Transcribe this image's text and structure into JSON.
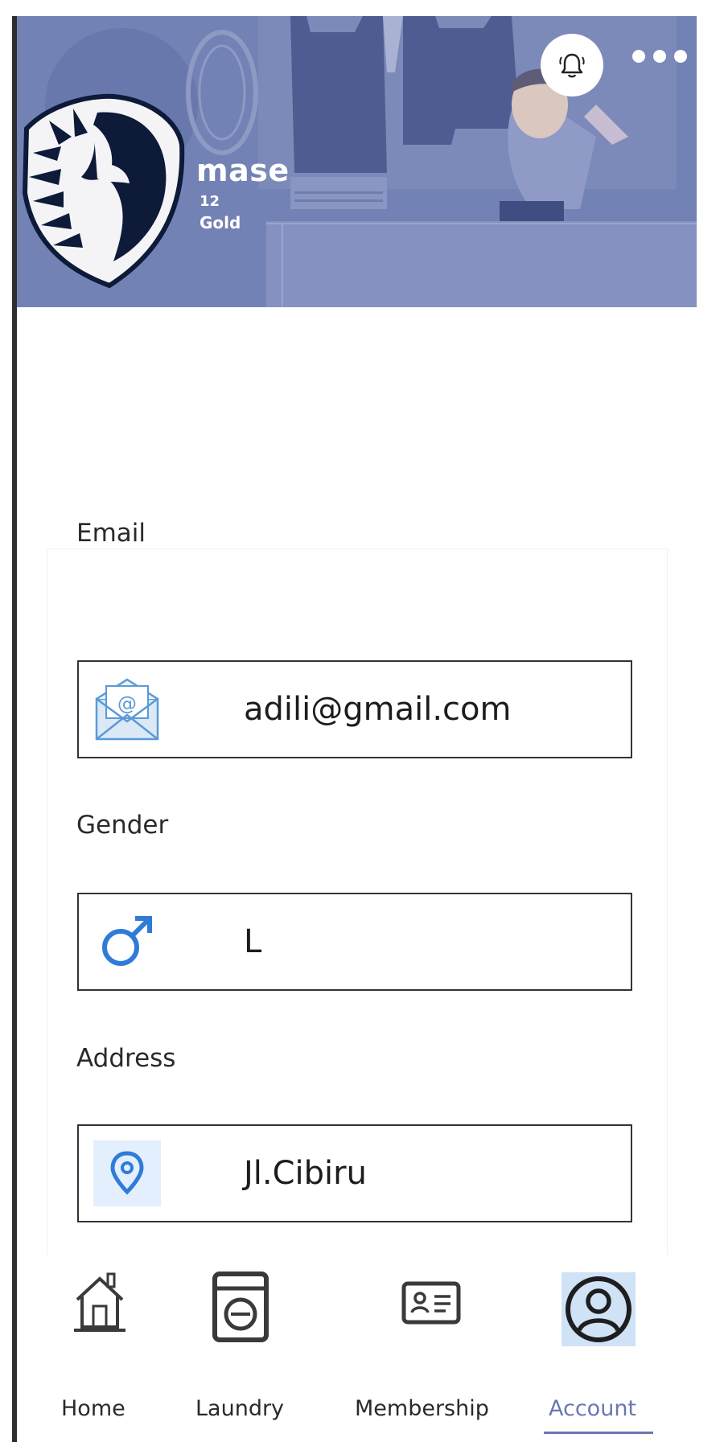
{
  "profile": {
    "name": "mase",
    "points": "12",
    "tier": "Gold"
  },
  "header": {
    "background_color": "#7382b5",
    "notification_icon": "bell-icon",
    "more_icon": "more-dots-icon",
    "avatar_icon": "horse-shield-logo"
  },
  "fields": {
    "email": {
      "label": "Email",
      "value": "adili@gmail.com",
      "icon": "email-envelope-icon"
    },
    "gender": {
      "label": "Gender",
      "value": "L",
      "icon": "male-symbol-icon"
    },
    "address": {
      "label": "Address",
      "value": "Jl.Cibiru",
      "icon": "location-pin-icon"
    }
  },
  "nav": {
    "active_color": "#6b77b0",
    "items": [
      {
        "label": "Home",
        "icon": "home-icon"
      },
      {
        "label": "Laundry",
        "icon": "washing-machine-icon"
      },
      {
        "label": "Membership",
        "icon": "membership-card-icon"
      },
      {
        "label": "Account",
        "icon": "account-icon",
        "active": true
      }
    ]
  }
}
